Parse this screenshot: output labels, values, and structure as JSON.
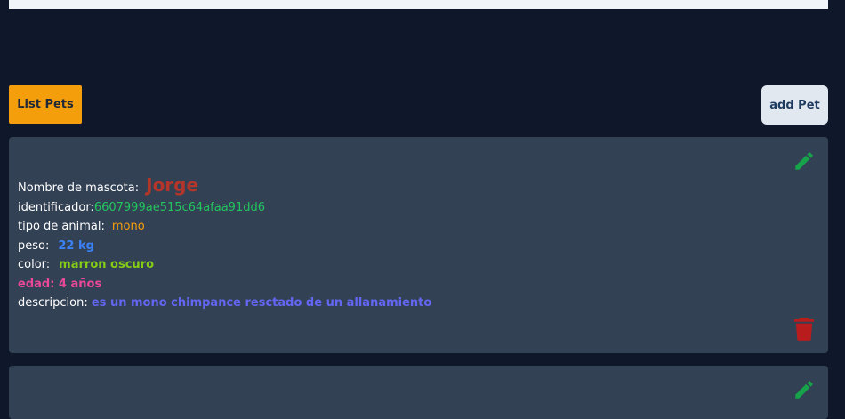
{
  "nav": {
    "list_label": "List Pets",
    "add_label": "add Pet"
  },
  "pets": [
    {
      "name_label": "Nombre de mascota:",
      "name": "Jorge",
      "id_label": "identificador:",
      "id": "6607999ae515c64afaa91dd6",
      "type_label": "tipo de animal:",
      "type": "mono",
      "weight_label": "peso:",
      "weight": "22 kg",
      "color_label": "color:",
      "color": "marron oscuro",
      "age_text": "edad: 4 años",
      "description_label": "descripcion:",
      "description": "es un mono chimpance resctado de un allanamiento"
    }
  ],
  "colors": {
    "background": "#0f172a",
    "card": "#334155",
    "list_button": "#f59e0b",
    "add_button": "#e2e8f0",
    "edit_icon": "#16a34a",
    "delete_icon": "#b91c1c"
  },
  "icons": {
    "edit": "pencil-icon",
    "delete": "trash-icon"
  }
}
